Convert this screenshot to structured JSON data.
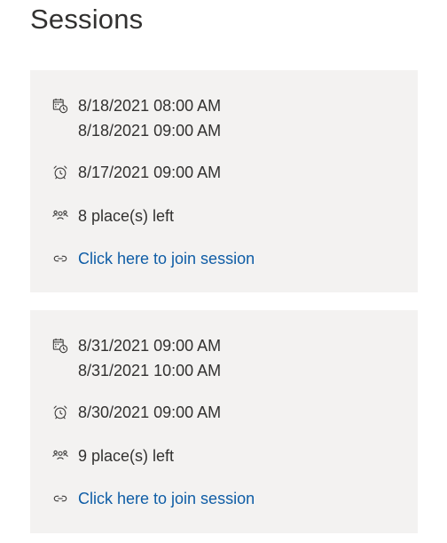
{
  "page": {
    "title": "Sessions"
  },
  "sessions": [
    {
      "start": "8/18/2021 08:00 AM",
      "end": "8/18/2021 09:00 AM",
      "reminder": "8/17/2021 09:00 AM",
      "places_left": "8 place(s) left",
      "join_link": "Click here to join session"
    },
    {
      "start": "8/31/2021 09:00 AM",
      "end": "8/31/2021 10:00 AM",
      "reminder": "8/30/2021 09:00 AM",
      "places_left": "9 place(s) left",
      "join_link": "Click here to join session"
    }
  ],
  "icons": {
    "date": "calendar-clock-icon",
    "reminder": "alarm-clock-icon",
    "places": "people-icon",
    "link": "link-icon"
  },
  "colors": {
    "card_background": "#f3f2f1",
    "link": "#0f5da6",
    "text": "#323130"
  }
}
